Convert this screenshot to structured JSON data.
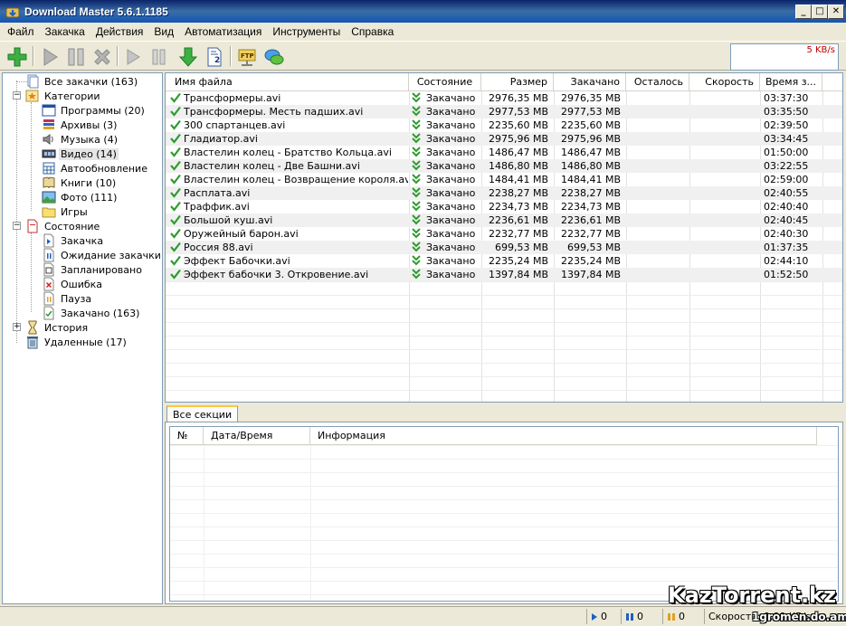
{
  "window": {
    "title": "Download Master 5.6.1.1185"
  },
  "menu": [
    "Файл",
    "Закачка",
    "Действия",
    "Вид",
    "Автоматизация",
    "Инструменты",
    "Справка"
  ],
  "toolbar": {
    "speed": "5 KB/s",
    "ftp_label": "FTP",
    "page_number": "2"
  },
  "tree": {
    "all": "Все закачки (163)",
    "categories": "Категории",
    "category_items": [
      "Программы (20)",
      "Архивы (3)",
      "Музыка (4)",
      "Видео (14)",
      "Автообновление",
      "Книги (10)",
      "Фото (111)",
      "Игры"
    ],
    "state": "Состояние",
    "state_items": [
      "Закачка",
      "Ожидание закачки",
      "Запланировано",
      "Ошибка",
      "Пауза",
      "Закачано (163)"
    ],
    "history": "История",
    "deleted": "Удаленные (17)"
  },
  "list": {
    "columns": [
      "Имя файла",
      "Состояние",
      "Размер",
      "Закачано",
      "Осталось",
      "Скорость",
      "Время з..."
    ],
    "rows": [
      [
        "Трансформеры.avi",
        "Закачано",
        "2976,35 MB",
        "2976,35 MB",
        "",
        "",
        "03:37:30"
      ],
      [
        "Трансформеры. Месть падших.avi",
        "Закачано",
        "2977,53 MB",
        "2977,53 MB",
        "",
        "",
        "03:35:50"
      ],
      [
        "300 спартанцев.avi",
        "Закачано",
        "2235,60 MB",
        "2235,60 MB",
        "",
        "",
        "02:39:50"
      ],
      [
        "Гладиатор.avi",
        "Закачано",
        "2975,96 MB",
        "2975,96 MB",
        "",
        "",
        "03:34:45"
      ],
      [
        "Властелин колец - Братство Кольца.avi",
        "Закачано",
        "1486,47 MB",
        "1486,47 MB",
        "",
        "",
        "01:50:00"
      ],
      [
        "Властелин колец - Две Башни.avi",
        "Закачано",
        "1486,80 MB",
        "1486,80 MB",
        "",
        "",
        "03:22:55"
      ],
      [
        "Властелин колец - Возвращение короля.avi",
        "Закачано",
        "1484,41 MB",
        "1484,41 MB",
        "",
        "",
        "02:59:00"
      ],
      [
        "Расплата.avi",
        "Закачано",
        "2238,27 MB",
        "2238,27 MB",
        "",
        "",
        "02:40:55"
      ],
      [
        "Траффик.avi",
        "Закачано",
        "2234,73 MB",
        "2234,73 MB",
        "",
        "",
        "02:40:40"
      ],
      [
        "Большой куш.avi",
        "Закачано",
        "2236,61 MB",
        "2236,61 MB",
        "",
        "",
        "02:40:45"
      ],
      [
        "Оружейный барон.avi",
        "Закачано",
        "2232,77 MB",
        "2232,77 MB",
        "",
        "",
        "02:40:30"
      ],
      [
        "Россия 88.avi",
        "Закачано",
        "699,53 MB",
        "699,53 MB",
        "",
        "",
        "01:37:35"
      ],
      [
        "Эффект Бабочки.avi",
        "Закачано",
        "2235,24 MB",
        "2235,24 MB",
        "",
        "",
        "02:44:10"
      ],
      [
        "Эффект бабочки 3. Откровение.avi",
        "Закачано",
        "1397,84 MB",
        "1397,84 MB",
        "",
        "",
        "01:52:50"
      ]
    ]
  },
  "log": {
    "tab": "Все секции",
    "columns": [
      "№",
      "Дата/Время",
      "Информация"
    ]
  },
  "status": {
    "active": "0",
    "waiting": "0",
    "paused": "0",
    "speed": "Скорость: 0,00 KB/s"
  },
  "watermark": {
    "main": "KazTorrent.kz",
    "sub": "1gromen.do.am"
  },
  "colors": {
    "title_bar": "#0a4fb8",
    "check_green": "#2e9b2e",
    "speed_text": "#c00000"
  }
}
